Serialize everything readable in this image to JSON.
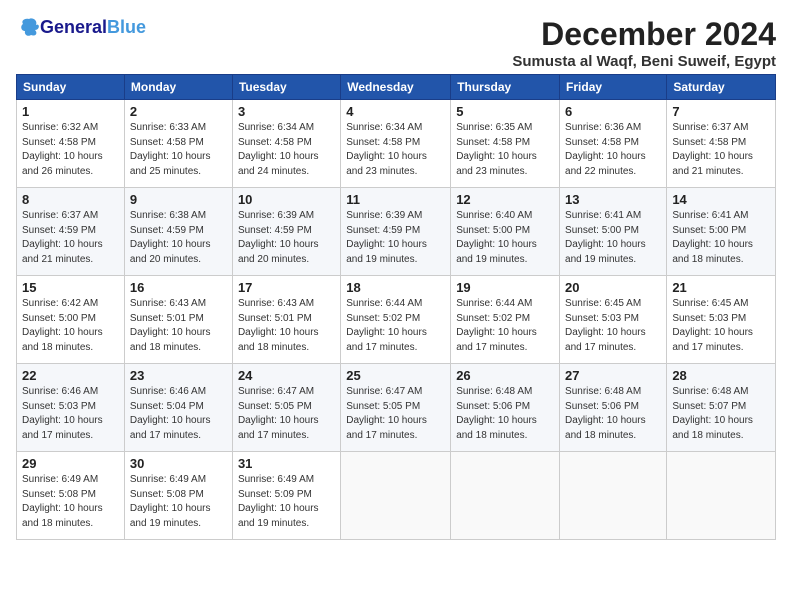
{
  "header": {
    "logo_general": "General",
    "logo_blue": "Blue",
    "month_title": "December 2024",
    "location": "Sumusta al Waqf, Beni Suweif, Egypt"
  },
  "weekdays": [
    "Sunday",
    "Monday",
    "Tuesday",
    "Wednesday",
    "Thursday",
    "Friday",
    "Saturday"
  ],
  "weeks": [
    [
      {
        "day": "1",
        "info": "Sunrise: 6:32 AM\nSunset: 4:58 PM\nDaylight: 10 hours\nand 26 minutes."
      },
      {
        "day": "2",
        "info": "Sunrise: 6:33 AM\nSunset: 4:58 PM\nDaylight: 10 hours\nand 25 minutes."
      },
      {
        "day": "3",
        "info": "Sunrise: 6:34 AM\nSunset: 4:58 PM\nDaylight: 10 hours\nand 24 minutes."
      },
      {
        "day": "4",
        "info": "Sunrise: 6:34 AM\nSunset: 4:58 PM\nDaylight: 10 hours\nand 23 minutes."
      },
      {
        "day": "5",
        "info": "Sunrise: 6:35 AM\nSunset: 4:58 PM\nDaylight: 10 hours\nand 23 minutes."
      },
      {
        "day": "6",
        "info": "Sunrise: 6:36 AM\nSunset: 4:58 PM\nDaylight: 10 hours\nand 22 minutes."
      },
      {
        "day": "7",
        "info": "Sunrise: 6:37 AM\nSunset: 4:58 PM\nDaylight: 10 hours\nand 21 minutes."
      }
    ],
    [
      {
        "day": "8",
        "info": "Sunrise: 6:37 AM\nSunset: 4:59 PM\nDaylight: 10 hours\nand 21 minutes."
      },
      {
        "day": "9",
        "info": "Sunrise: 6:38 AM\nSunset: 4:59 PM\nDaylight: 10 hours\nand 20 minutes."
      },
      {
        "day": "10",
        "info": "Sunrise: 6:39 AM\nSunset: 4:59 PM\nDaylight: 10 hours\nand 20 minutes."
      },
      {
        "day": "11",
        "info": "Sunrise: 6:39 AM\nSunset: 4:59 PM\nDaylight: 10 hours\nand 19 minutes."
      },
      {
        "day": "12",
        "info": "Sunrise: 6:40 AM\nSunset: 5:00 PM\nDaylight: 10 hours\nand 19 minutes."
      },
      {
        "day": "13",
        "info": "Sunrise: 6:41 AM\nSunset: 5:00 PM\nDaylight: 10 hours\nand 19 minutes."
      },
      {
        "day": "14",
        "info": "Sunrise: 6:41 AM\nSunset: 5:00 PM\nDaylight: 10 hours\nand 18 minutes."
      }
    ],
    [
      {
        "day": "15",
        "info": "Sunrise: 6:42 AM\nSunset: 5:00 PM\nDaylight: 10 hours\nand 18 minutes."
      },
      {
        "day": "16",
        "info": "Sunrise: 6:43 AM\nSunset: 5:01 PM\nDaylight: 10 hours\nand 18 minutes."
      },
      {
        "day": "17",
        "info": "Sunrise: 6:43 AM\nSunset: 5:01 PM\nDaylight: 10 hours\nand 18 minutes."
      },
      {
        "day": "18",
        "info": "Sunrise: 6:44 AM\nSunset: 5:02 PM\nDaylight: 10 hours\nand 17 minutes."
      },
      {
        "day": "19",
        "info": "Sunrise: 6:44 AM\nSunset: 5:02 PM\nDaylight: 10 hours\nand 17 minutes."
      },
      {
        "day": "20",
        "info": "Sunrise: 6:45 AM\nSunset: 5:03 PM\nDaylight: 10 hours\nand 17 minutes."
      },
      {
        "day": "21",
        "info": "Sunrise: 6:45 AM\nSunset: 5:03 PM\nDaylight: 10 hours\nand 17 minutes."
      }
    ],
    [
      {
        "day": "22",
        "info": "Sunrise: 6:46 AM\nSunset: 5:03 PM\nDaylight: 10 hours\nand 17 minutes."
      },
      {
        "day": "23",
        "info": "Sunrise: 6:46 AM\nSunset: 5:04 PM\nDaylight: 10 hours\nand 17 minutes."
      },
      {
        "day": "24",
        "info": "Sunrise: 6:47 AM\nSunset: 5:05 PM\nDaylight: 10 hours\nand 17 minutes."
      },
      {
        "day": "25",
        "info": "Sunrise: 6:47 AM\nSunset: 5:05 PM\nDaylight: 10 hours\nand 17 minutes."
      },
      {
        "day": "26",
        "info": "Sunrise: 6:48 AM\nSunset: 5:06 PM\nDaylight: 10 hours\nand 18 minutes."
      },
      {
        "day": "27",
        "info": "Sunrise: 6:48 AM\nSunset: 5:06 PM\nDaylight: 10 hours\nand 18 minutes."
      },
      {
        "day": "28",
        "info": "Sunrise: 6:48 AM\nSunset: 5:07 PM\nDaylight: 10 hours\nand 18 minutes."
      }
    ],
    [
      {
        "day": "29",
        "info": "Sunrise: 6:49 AM\nSunset: 5:08 PM\nDaylight: 10 hours\nand 18 minutes."
      },
      {
        "day": "30",
        "info": "Sunrise: 6:49 AM\nSunset: 5:08 PM\nDaylight: 10 hours\nand 19 minutes."
      },
      {
        "day": "31",
        "info": "Sunrise: 6:49 AM\nSunset: 5:09 PM\nDaylight: 10 hours\nand 19 minutes."
      },
      null,
      null,
      null,
      null
    ]
  ]
}
